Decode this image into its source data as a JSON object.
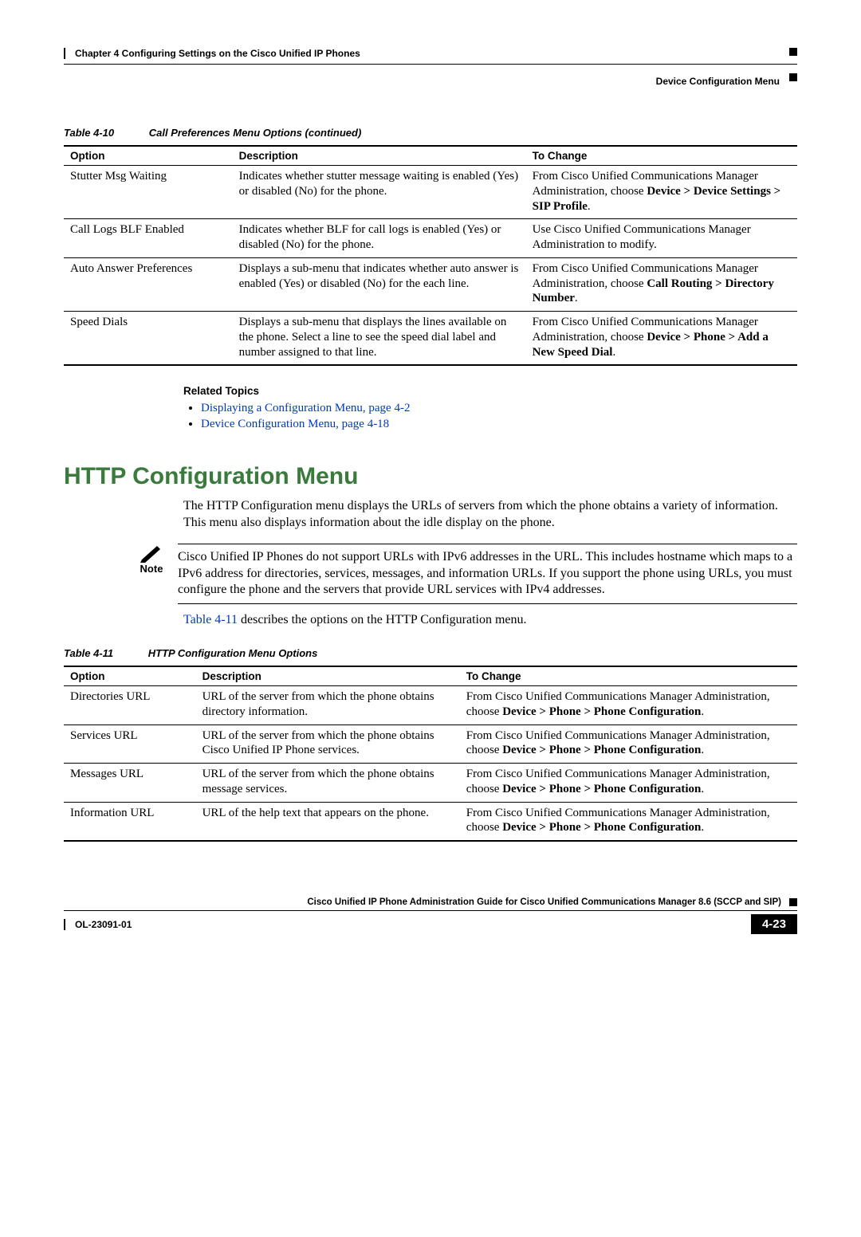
{
  "header": {
    "chapter": "Chapter 4      Configuring Settings on the Cisco Unified IP Phones",
    "section": "Device Configuration Menu"
  },
  "table410": {
    "caption_num": "Table 4-10",
    "caption_title": "Call Preferences Menu Options (continued)",
    "head": {
      "c1": "Option",
      "c2": "Description",
      "c3": "To Change"
    },
    "rows": [
      {
        "c1": "Stutter Msg Waiting",
        "c2": "Indicates whether stutter message waiting is enabled (Yes) or disabled (No) for the phone.",
        "c3_pre": "From Cisco Unified Communications Manager Administration, choose ",
        "c3_b": "Device > Device Settings > SIP Profile",
        "c3_post": "."
      },
      {
        "c1": "Call Logs BLF Enabled",
        "c2": "Indicates whether BLF for call logs is enabled (Yes) or disabled (No) for the phone.",
        "c3_pre": "Use Cisco Unified Communications Manager Administration to modify.",
        "c3_b": "",
        "c3_post": ""
      },
      {
        "c1": "Auto Answer Preferences",
        "c2": "Displays a sub-menu that indicates whether auto answer is enabled (Yes) or disabled (No) for the each line.",
        "c3_pre": "From Cisco Unified Communications Manager Administration, choose ",
        "c3_b": "Call Routing > Directory Number",
        "c3_post": "."
      },
      {
        "c1": "Speed Dials",
        "c2": "Displays a sub-menu that displays the lines available on the phone. Select a line to see the speed dial label and number assigned to that line.",
        "c3_pre": "From Cisco Unified Communications Manager Administration, choose ",
        "c3_b": "Device > Phone > Add a New Speed Dial",
        "c3_post": "."
      }
    ]
  },
  "related": {
    "heading": "Related Topics",
    "items": [
      "Displaying a Configuration Menu, page 4-2",
      "Device Configuration Menu, page 4-18"
    ]
  },
  "section_title": "HTTP Configuration Menu",
  "intro_p": "The HTTP Configuration menu displays the URLs of servers from which the phone obtains a variety of information. This menu also displays information about the idle display on the phone.",
  "note_label": "Note",
  "note_text": "Cisco Unified IP Phones do not support URLs with IPv6 addresses in the URL. This includes hostname which maps to a IPv6 address for directories, services, messages, and information URLs. If you support the phone using URLs, you must configure the phone and the servers that provide URL services with IPv4 addresses.",
  "desc_link": "Table 4-11",
  "desc_after": " describes the options on the HTTP Configuration menu.",
  "table411": {
    "caption_num": "Table 4-11",
    "caption_title": "HTTP Configuration Menu Options",
    "head": {
      "c1": "Option",
      "c2": "Description",
      "c3": "To Change"
    },
    "rows": [
      {
        "c1": "Directories URL",
        "c2": "URL of the server from which the phone obtains directory information.",
        "c3_pre": "From Cisco Unified Communications Manager Administration, choose ",
        "c3_b": "Device > Phone > Phone Configuration",
        "c3_post": "."
      },
      {
        "c1": "Services URL",
        "c2": "URL of the server from which the phone obtains Cisco Unified IP Phone services.",
        "c3_pre": "From Cisco Unified Communications Manager Administration, choose ",
        "c3_b": "Device > Phone > Phone Configuration",
        "c3_post": "."
      },
      {
        "c1": "Messages URL",
        "c2": "URL of the server from which the phone obtains message services.",
        "c3_pre": "From Cisco Unified Communications Manager Administration, choose ",
        "c3_b": "Device > Phone > Phone Configuration",
        "c3_post": "."
      },
      {
        "c1": "Information URL",
        "c2": "URL of the help text that appears on the phone.",
        "c3_pre": "From Cisco Unified Communications Manager Administration, choose ",
        "c3_b": "Device > Phone > Phone Configuration",
        "c3_post": "."
      }
    ]
  },
  "footer": {
    "guide": "Cisco Unified IP Phone Administration Guide for Cisco Unified Communications Manager 8.6 (SCCP and SIP)",
    "doc_id": "OL-23091-01",
    "page": "4-23"
  }
}
